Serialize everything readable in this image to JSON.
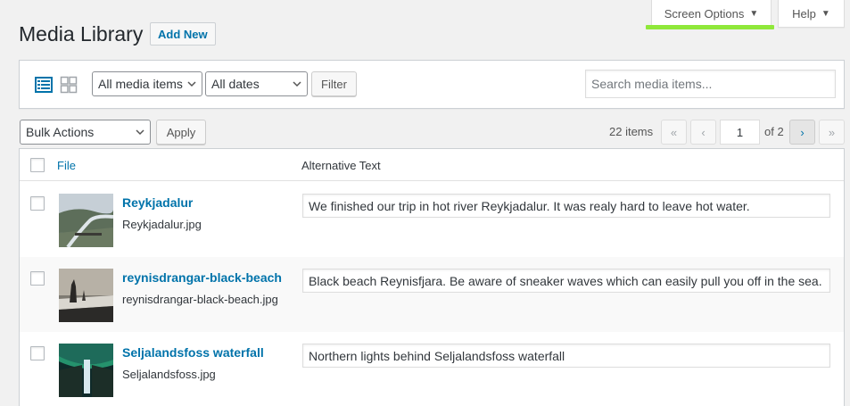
{
  "screen_options": {
    "label": "Screen Options"
  },
  "help": {
    "label": "Help"
  },
  "header": {
    "title": "Media Library",
    "add_new_label": "Add New"
  },
  "filters": {
    "media_type": "All media items",
    "dates": "All dates",
    "filter_label": "Filter",
    "search_placeholder": "Search media items..."
  },
  "bulk": {
    "selected": "Bulk Actions",
    "apply_label": "Apply"
  },
  "pagination": {
    "items_count": "22 items",
    "first": "«",
    "prev": "‹",
    "current_page": "1",
    "total": "of 2",
    "next": "›",
    "last": "»"
  },
  "table": {
    "columns": {
      "file": "File",
      "alt": "Alternative Text"
    },
    "rows": [
      {
        "title": "Reykjadalur",
        "filename": "Reykjadalur.jpg",
        "alt_text": "We finished our trip in hot river Reykjadalur. It was realy hard to leave hot water."
      },
      {
        "title": "reynisdrangar-black-beach",
        "filename": "reynisdrangar-black-beach.jpg",
        "alt_text": "Black beach Reynisfjara. Be aware of sneaker waves which can easily pull you off in the sea."
      },
      {
        "title": "Seljalandsfoss waterfall",
        "filename": "Seljalandsfoss.jpg",
        "alt_text": "Northern lights behind Seljalandsfoss waterfall"
      }
    ]
  },
  "colors": {
    "link": "#0073aa",
    "highlight": "#8fe83a",
    "background": "#f1f1f1"
  },
  "icons": [
    "list-view-icon",
    "grid-view-icon",
    "chevron-down-icon",
    "triangle-down-icon"
  ]
}
